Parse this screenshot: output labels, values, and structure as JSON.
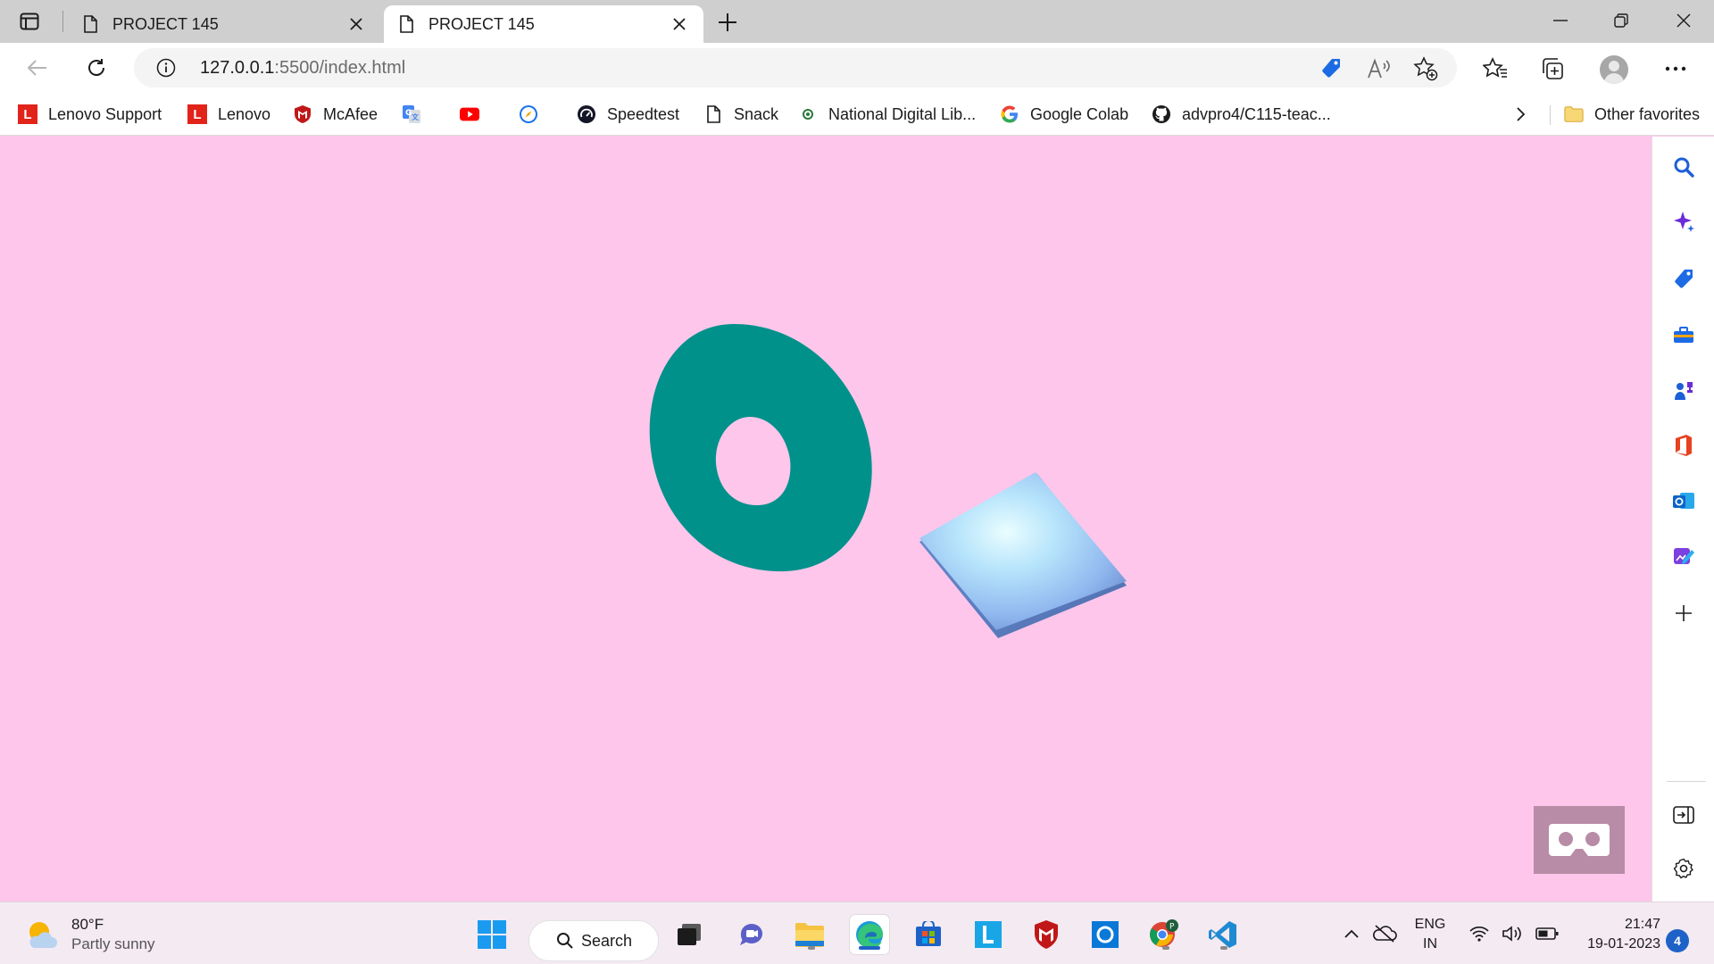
{
  "browser": {
    "tabs": [
      {
        "title": "PROJECT 145",
        "active": false
      },
      {
        "title": "PROJECT 145",
        "active": true
      }
    ],
    "address": {
      "host": "127.0.0.1",
      "path": ":5500/index.html"
    }
  },
  "favorites": {
    "items": [
      {
        "label": "Lenovo Support",
        "icon": "lenovo-icon"
      },
      {
        "label": "Lenovo",
        "icon": "lenovo-icon"
      },
      {
        "label": "McAfee",
        "icon": "mcafee-icon"
      },
      {
        "label": "",
        "icon": "google-translate-icon"
      },
      {
        "label": "",
        "icon": "youtube-icon"
      },
      {
        "label": "",
        "icon": "compass-icon"
      },
      {
        "label": "Speedtest",
        "icon": "speedtest-icon"
      },
      {
        "label": "Snack",
        "icon": "page-icon"
      },
      {
        "label": "National Digital Lib...",
        "icon": "dot-icon"
      },
      {
        "label": "Google Colab",
        "icon": "google-icon"
      },
      {
        "label": "advpro4/C115-teac...",
        "icon": "github-icon"
      }
    ],
    "other_label": "Other favorites"
  },
  "scene": {
    "background": "#fdc6ea",
    "ring_color": "#00918b",
    "cube_color": "#9ec8f7"
  },
  "taskbar": {
    "weather_temp": "80°F",
    "weather_desc": "Partly sunny",
    "search_label": "Search",
    "lang_top": "ENG",
    "lang_bottom": "IN",
    "time": "21:47",
    "date": "19-01-2023",
    "notification_count": "4"
  }
}
